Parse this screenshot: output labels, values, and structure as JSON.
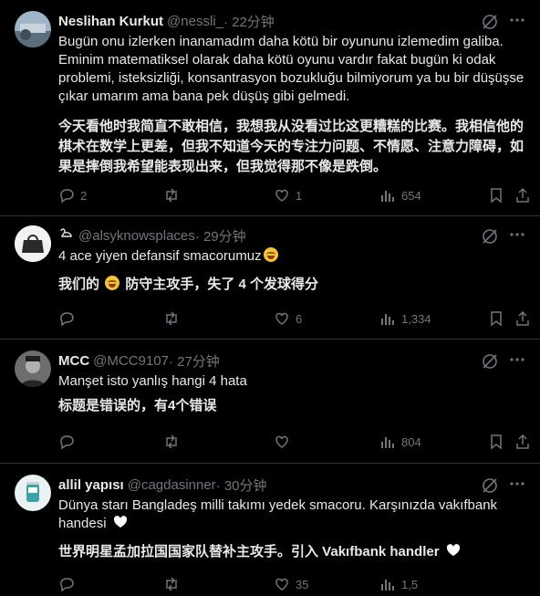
{
  "tweets": [
    {
      "name": "Neslihan Kurkut",
      "handle": "@nessli_",
      "time": " · 22分钟",
      "text": "Bugün onu izlerken inanamadım daha kötü bir oyununu izlemedim galiba. Eminim matematiksel olarak daha kötü oyunu vardır fakat bugün ki odak problemi, isteksizliği, konsantrasyon bozukluğu bilmiyorum ya bu bir düşüşse çıkar umarım ama bana pek düşüş gibi gelmedi.",
      "translation": "今天看他时我简直不敢相信，我想我从没看过比这更糟糕的比赛。我相信他的棋术在数学上更差，但我不知道今天的专注力问题、不情愿、注意力障碍，如果是摔倒我希望能表现出来，但我觉得那不像是跌倒。",
      "replies": "2",
      "retweets": "",
      "likes": "1",
      "views": "654"
    },
    {
      "name": "",
      "handle": "@alsyknowsplaces",
      "time": " · 29分钟",
      "text": "4 ace yiyen defansif smacorumuz",
      "translation_pre": "我们的",
      "translation_post": "防守主攻手，失了 4 个发球得分",
      "replies": "",
      "retweets": "",
      "likes": "6",
      "views": "1,334"
    },
    {
      "name": "MCC",
      "handle": "@MCC9107",
      "time": " · 27分钟",
      "text": "Manşet isto yanlış hangi 4 hata",
      "translation": "标题是错误的，有4个错误",
      "replies": "",
      "retweets": "",
      "likes": "",
      "views": "804"
    },
    {
      "name": "allil yapısı",
      "handle": "@cagdasinner",
      "time": " · 30分钟",
      "text": "Dünya starı Bangladeş milli takımı yedek smacoru. Karşınızda vakıfbank handesi",
      "translation": "世界明星孟加拉国国家队替补主攻手。引入 Vakıfbank handler",
      "replies": "",
      "retweets": "",
      "likes": "35",
      "views": "1,5"
    }
  ],
  "icons": {
    "reply": "reply-icon",
    "retweet": "retweet-icon",
    "like": "heart-icon",
    "views": "views-icon",
    "bookmark": "bookmark-icon",
    "share": "share-icon",
    "grok": "grok-icon",
    "more": "more-icon"
  },
  "colors": {
    "background": "#000000",
    "text": "#e7e9ea",
    "muted": "#71767b",
    "border": "#2f3336"
  }
}
